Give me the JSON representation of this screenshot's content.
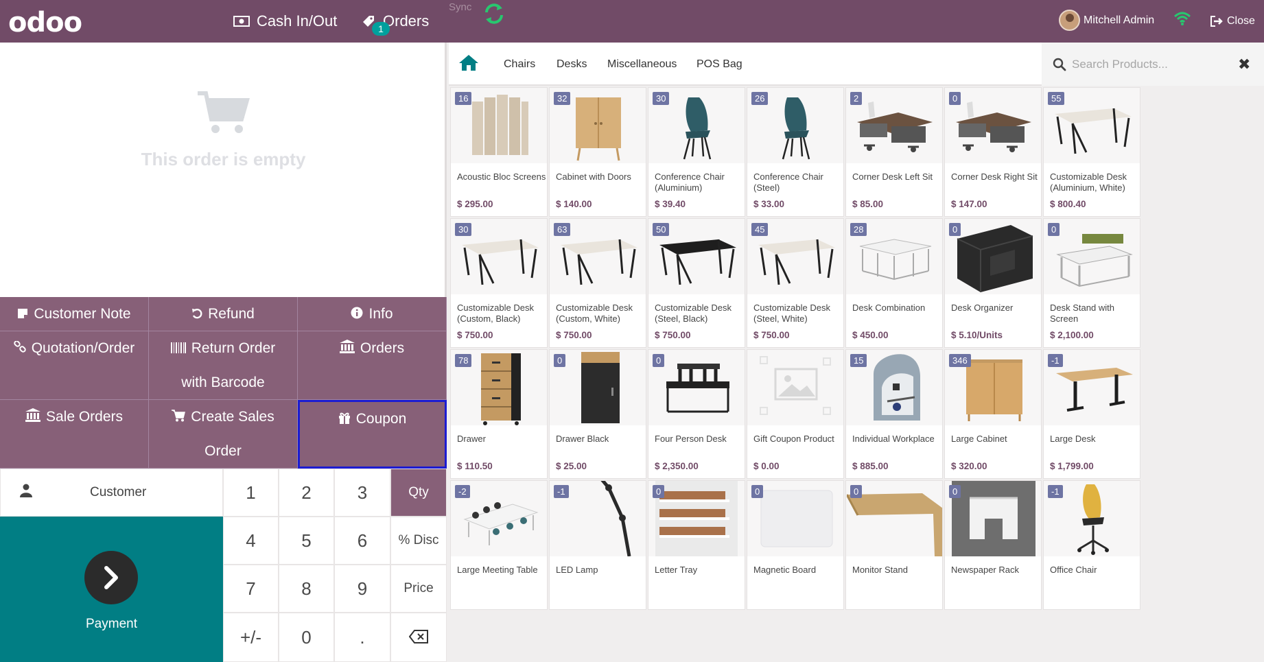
{
  "navbar": {
    "logo": "odoo",
    "cash_label": "Cash In/Out",
    "orders_label": "Orders",
    "orders_badge": "1",
    "sync_label": "Sync",
    "user_name": "Mitchell Admin",
    "close_label": "Close"
  },
  "order": {
    "empty_text": "This order is empty"
  },
  "controls": {
    "customer_note": "Customer Note",
    "refund": "Refund",
    "info": "Info",
    "quotation": "Quotation/Order",
    "return_order_1": "Return Order",
    "return_order_2": "with Barcode",
    "orders": "Orders",
    "sale_orders": "Sale Orders",
    "create_sales_1": "Create Sales",
    "create_sales_2": "Order",
    "coupon": "Coupon"
  },
  "numpad": {
    "customer": "Customer",
    "keys": [
      "1",
      "2",
      "3",
      "4",
      "5",
      "6",
      "7",
      "8",
      "9",
      "+/-",
      "0",
      "."
    ],
    "qty": "Qty",
    "disc": "% Disc",
    "price": "Price",
    "payment": "Payment"
  },
  "categories": [
    "Chairs",
    "Desks",
    "Miscellaneous",
    "POS Bag"
  ],
  "search": {
    "placeholder": "Search Products..."
  },
  "colors": {
    "brand": "#714b67",
    "button": "#876078",
    "teal": "#017e84",
    "qty_badge": "#6e74a3",
    "selected": "#1c1cd2"
  },
  "products": [
    {
      "qty": "16",
      "name": "Acoustic Bloc Screens",
      "price": "$ 295.00",
      "icon": "screen"
    },
    {
      "qty": "32",
      "name": "Cabinet with Doors",
      "price": "$ 140.00",
      "icon": "cabinet"
    },
    {
      "qty": "30",
      "name": "Conference Chair (Aluminium)",
      "price": "$ 39.40",
      "icon": "chair"
    },
    {
      "qty": "26",
      "name": "Conference Chair (Steel)",
      "price": "$ 33.00",
      "icon": "chair"
    },
    {
      "qty": "2",
      "name": "Corner Desk Left Sit",
      "price": "$ 85.00",
      "icon": "corner-desk"
    },
    {
      "qty": "0",
      "name": "Corner Desk Right Sit",
      "price": "$ 147.00",
      "icon": "corner-desk"
    },
    {
      "qty": "55",
      "name": "Customizable Desk (Aluminium, White)",
      "price": "$ 800.40",
      "icon": "desk-white"
    },
    {
      "qty": "30",
      "name": "Customizable Desk (Custom, Black)",
      "price": "$ 750.00",
      "icon": "desk-white"
    },
    {
      "qty": "63",
      "name": "Customizable Desk (Custom, White)",
      "price": "$ 750.00",
      "icon": "desk-white"
    },
    {
      "qty": "50",
      "name": "Customizable Desk (Steel, Black)",
      "price": "$ 750.00",
      "icon": "desk-black"
    },
    {
      "qty": "45",
      "name": "Customizable Desk (Steel, White)",
      "price": "$ 750.00",
      "icon": "desk-white"
    },
    {
      "qty": "28",
      "name": "Desk Combination",
      "price": "$ 450.00",
      "icon": "desk-combo"
    },
    {
      "qty": "0",
      "name": "Desk Organizer",
      "price": "$ 5.10/Units",
      "icon": "organizer"
    },
    {
      "qty": "0",
      "name": "Desk Stand with Screen",
      "price": "$ 2,100.00",
      "icon": "desk-stand"
    },
    {
      "qty": "78",
      "name": "Drawer",
      "price": "$ 110.50",
      "icon": "drawer"
    },
    {
      "qty": "0",
      "name": "Drawer Black",
      "price": "$ 25.00",
      "icon": "drawer-black"
    },
    {
      "qty": "0",
      "name": "Four Person Desk",
      "price": "$ 2,350.00",
      "icon": "four-desk"
    },
    {
      "qty": "",
      "name": "Gift Coupon Product",
      "price": "$ 0.00",
      "icon": "placeholder"
    },
    {
      "qty": "15",
      "name": "Individual Workplace",
      "price": "$ 885.00",
      "icon": "workplace"
    },
    {
      "qty": "346",
      "name": "Large Cabinet",
      "price": "$ 320.00",
      "icon": "large-cabinet"
    },
    {
      "qty": "-1",
      "name": "Large Desk",
      "price": "$ 1,799.00",
      "icon": "large-desk"
    },
    {
      "qty": "-2",
      "name": "Large Meeting Table",
      "price": "",
      "icon": "meeting"
    },
    {
      "qty": "-1",
      "name": "LED Lamp",
      "price": "",
      "icon": "lamp"
    },
    {
      "qty": "0",
      "name": "Letter Tray",
      "price": "",
      "icon": "tray"
    },
    {
      "qty": "0",
      "name": "Magnetic Board",
      "price": "",
      "icon": "board"
    },
    {
      "qty": "0",
      "name": "Monitor Stand",
      "price": "",
      "icon": "monitor-stand"
    },
    {
      "qty": "0",
      "name": "Newspaper Rack",
      "price": "",
      "icon": "rack"
    },
    {
      "qty": "-1",
      "name": "Office Chair",
      "price": "",
      "icon": "office-chair"
    }
  ]
}
